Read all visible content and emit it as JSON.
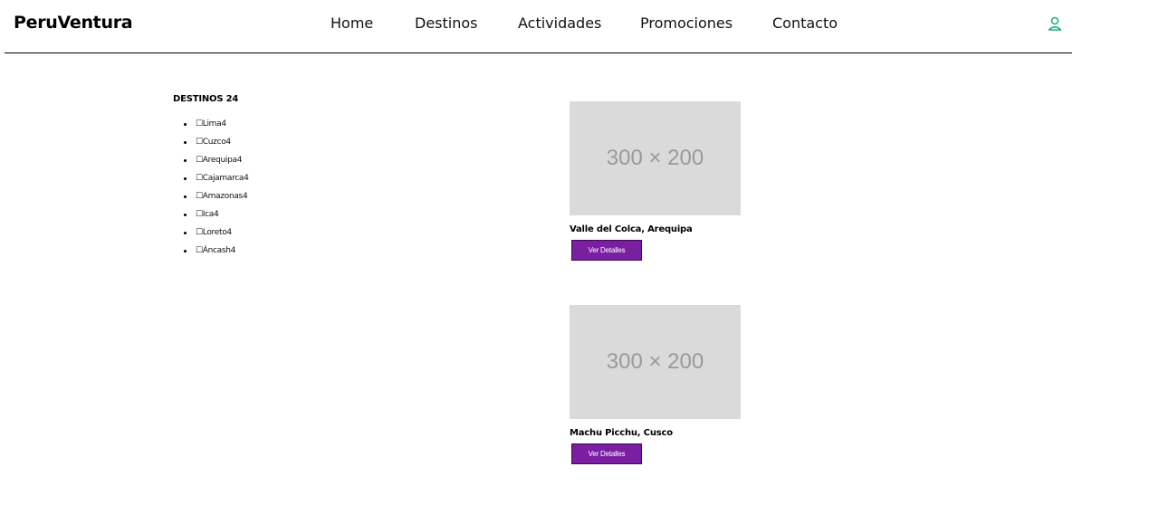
{
  "header": {
    "brand": "PeruVentura",
    "nav": [
      {
        "label": "Home"
      },
      {
        "label": "Destinos"
      },
      {
        "label": "Actividades"
      },
      {
        "label": "Promociones"
      },
      {
        "label": "Contacto"
      }
    ],
    "user_icon": "user-icon",
    "accent_color": "#1db37a"
  },
  "sidebar": {
    "title": "DESTINOS 24",
    "filters": [
      {
        "label": "☐Lima4"
      },
      {
        "label": "☐Cuzco4"
      },
      {
        "label": "☐Arequipa4"
      },
      {
        "label": "☐Cajamarca4"
      },
      {
        "label": "☐Amazonas4"
      },
      {
        "label": "☐Ica4"
      },
      {
        "label": "☐Loreto4"
      },
      {
        "label": "☐Áncash4"
      }
    ]
  },
  "main": {
    "cards": [
      {
        "image_text": "300 × 200",
        "title": "Valle del Colca, Arequipa",
        "button": "Ver Detalles"
      },
      {
        "image_text": "300 × 200",
        "title": "Machu Picchu, Cusco",
        "button": "Ver Detalles"
      }
    ],
    "button_color": "#7b1fa2"
  }
}
